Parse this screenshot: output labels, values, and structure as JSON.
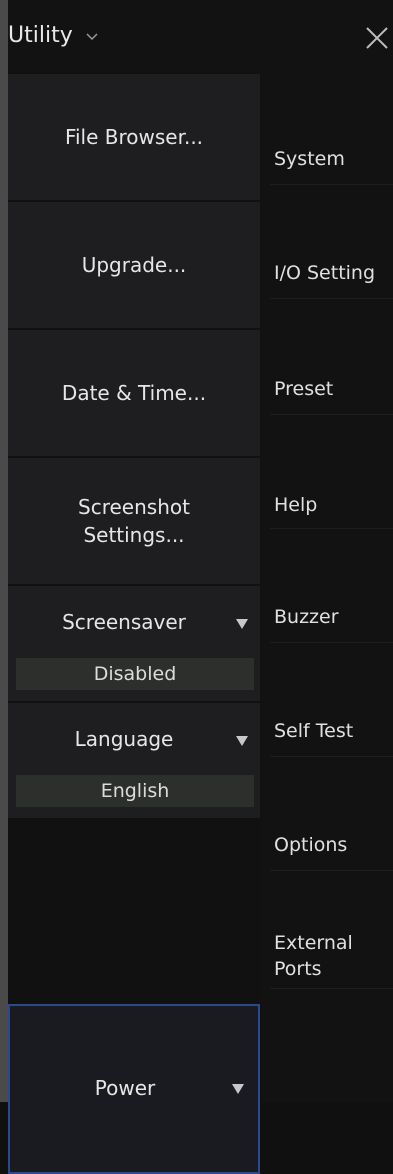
{
  "header": {
    "title": "Utility",
    "dropdown_icon": "chevron-down-icon",
    "close_icon": "close-icon"
  },
  "left_menu": {
    "file_browser": "File Browser...",
    "upgrade": "Upgrade...",
    "date_time": "Date & Time...",
    "screenshot_settings": "Screenshot\nSettings...",
    "screensaver": {
      "label": "Screensaver",
      "value": "Disabled"
    },
    "language": {
      "label": "Language",
      "value": "English"
    },
    "power": "Power"
  },
  "right_menu": {
    "items": [
      {
        "label": "System"
      },
      {
        "label": "I/O Setting"
      },
      {
        "label": "Preset"
      },
      {
        "label": "Help"
      },
      {
        "label": "Buzzer"
      },
      {
        "label": "Self Test"
      },
      {
        "label": "Options"
      },
      {
        "label": "External\nPorts"
      }
    ]
  },
  "colors": {
    "background": "#111112",
    "button": "#1e1e20",
    "value_field": "#2d2f2d",
    "selected_border": "#2b4a8e",
    "text": "#e6e6e6"
  }
}
